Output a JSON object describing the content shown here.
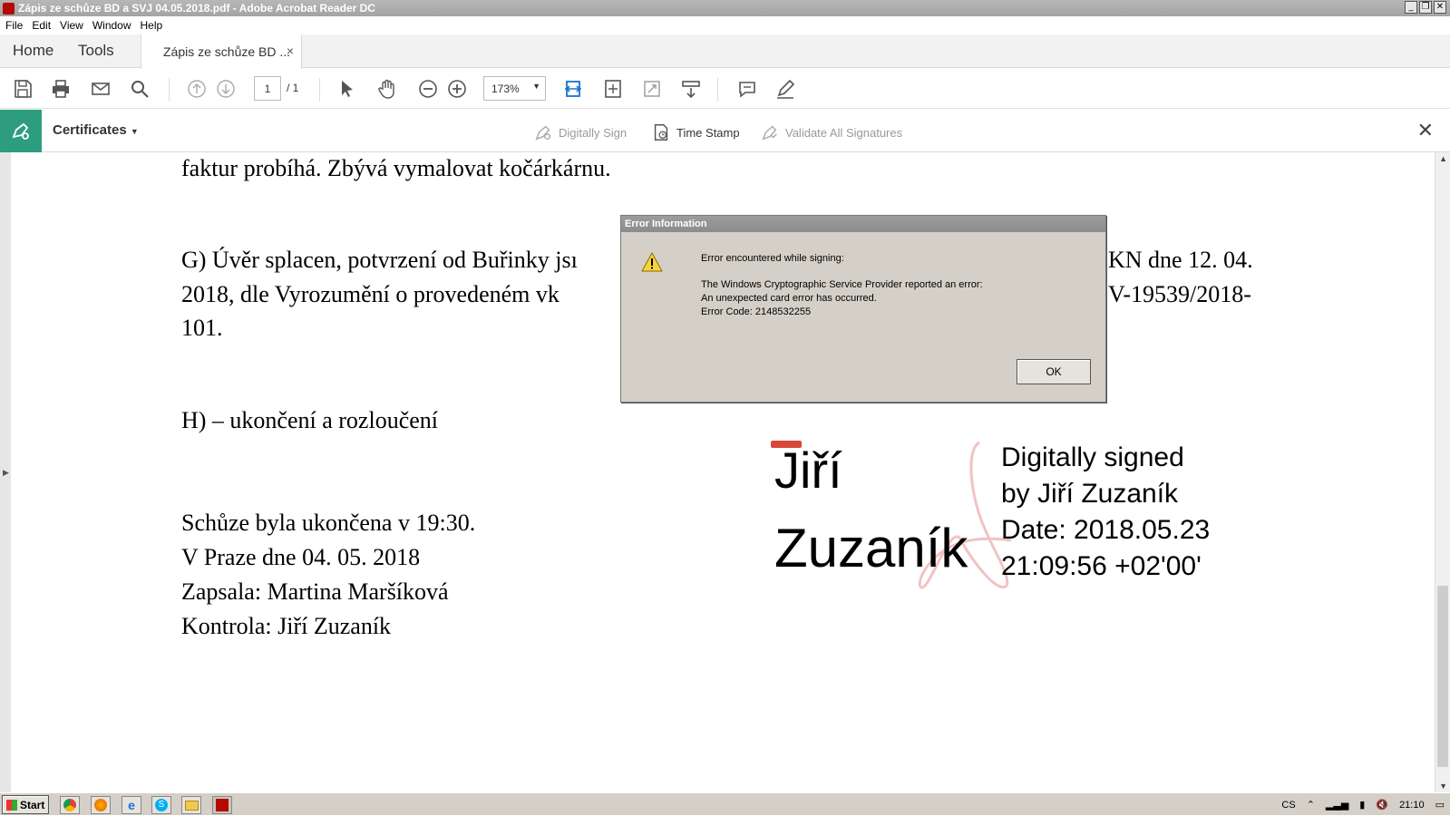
{
  "window": {
    "title": "Zápis ze schůze BD a SVJ 04.05.2018.pdf - Adobe Acrobat Reader DC",
    "controls": [
      "minimize",
      "restore",
      "close"
    ]
  },
  "menu": [
    "File",
    "Edit",
    "View",
    "Window",
    "Help"
  ],
  "tabs": {
    "home": "Home",
    "tools": "Tools",
    "document": "Zápis ze schůze BD ...",
    "close": "×"
  },
  "toolbar": {
    "page_current": "1",
    "page_total": "/ 1",
    "zoom": "173%",
    "icons": [
      "save-icon",
      "print-icon",
      "email-icon",
      "search-icon",
      "page-up-icon",
      "page-down-icon",
      "select-icon",
      "hand-icon",
      "zoom-out-icon",
      "zoom-in-icon",
      "fit-page-icon",
      "fit-width-icon",
      "full-screen-icon",
      "scroll-mode-icon",
      "comment-icon",
      "sign-icon"
    ]
  },
  "certbar": {
    "label": "Certificates",
    "digitally_sign": "Digitally Sign",
    "time_stamp": "Time Stamp",
    "validate_all": "Validate All Signatures"
  },
  "document": {
    "line1": "faktur probíhá. Zbývá vymalovat kočárkárnu.",
    "g_line1_left": "G) Úvěr splacen, potvrzení od Buřinky jsı",
    "g_line1_right": "KN dne 12. 04.",
    "g_line2_left": "2018, dle Vyrozumění o provedeném vk",
    "g_line2_right": "V-19539/2018-",
    "g_line3": "101.",
    "h_line": "H) – ukončení a rozloučení",
    "closing": [
      "Schůze byla ukončena v 19:30.",
      "V Praze dne 04. 05. 2018",
      "Zapsala: Martina Maršíková",
      "Kontrola: Jiří Zuzaník"
    ]
  },
  "signature": {
    "first_name": "Jiří",
    "last_name": "Zuzaník",
    "info": [
      "Digitally signed",
      "by Jiří Zuzaník",
      "Date: 2018.05.23",
      "21:09:56 +02'00'"
    ]
  },
  "dialog": {
    "title": "Error Information",
    "line1": "Error encountered while signing:",
    "line2": "The Windows Cryptographic Service Provider reported an error:",
    "line3": "An unexpected card error has occurred.",
    "line4": "Error Code: 2148532255",
    "ok": "OK"
  },
  "taskbar": {
    "start": "Start",
    "lang": "CS",
    "time": "21:10"
  }
}
